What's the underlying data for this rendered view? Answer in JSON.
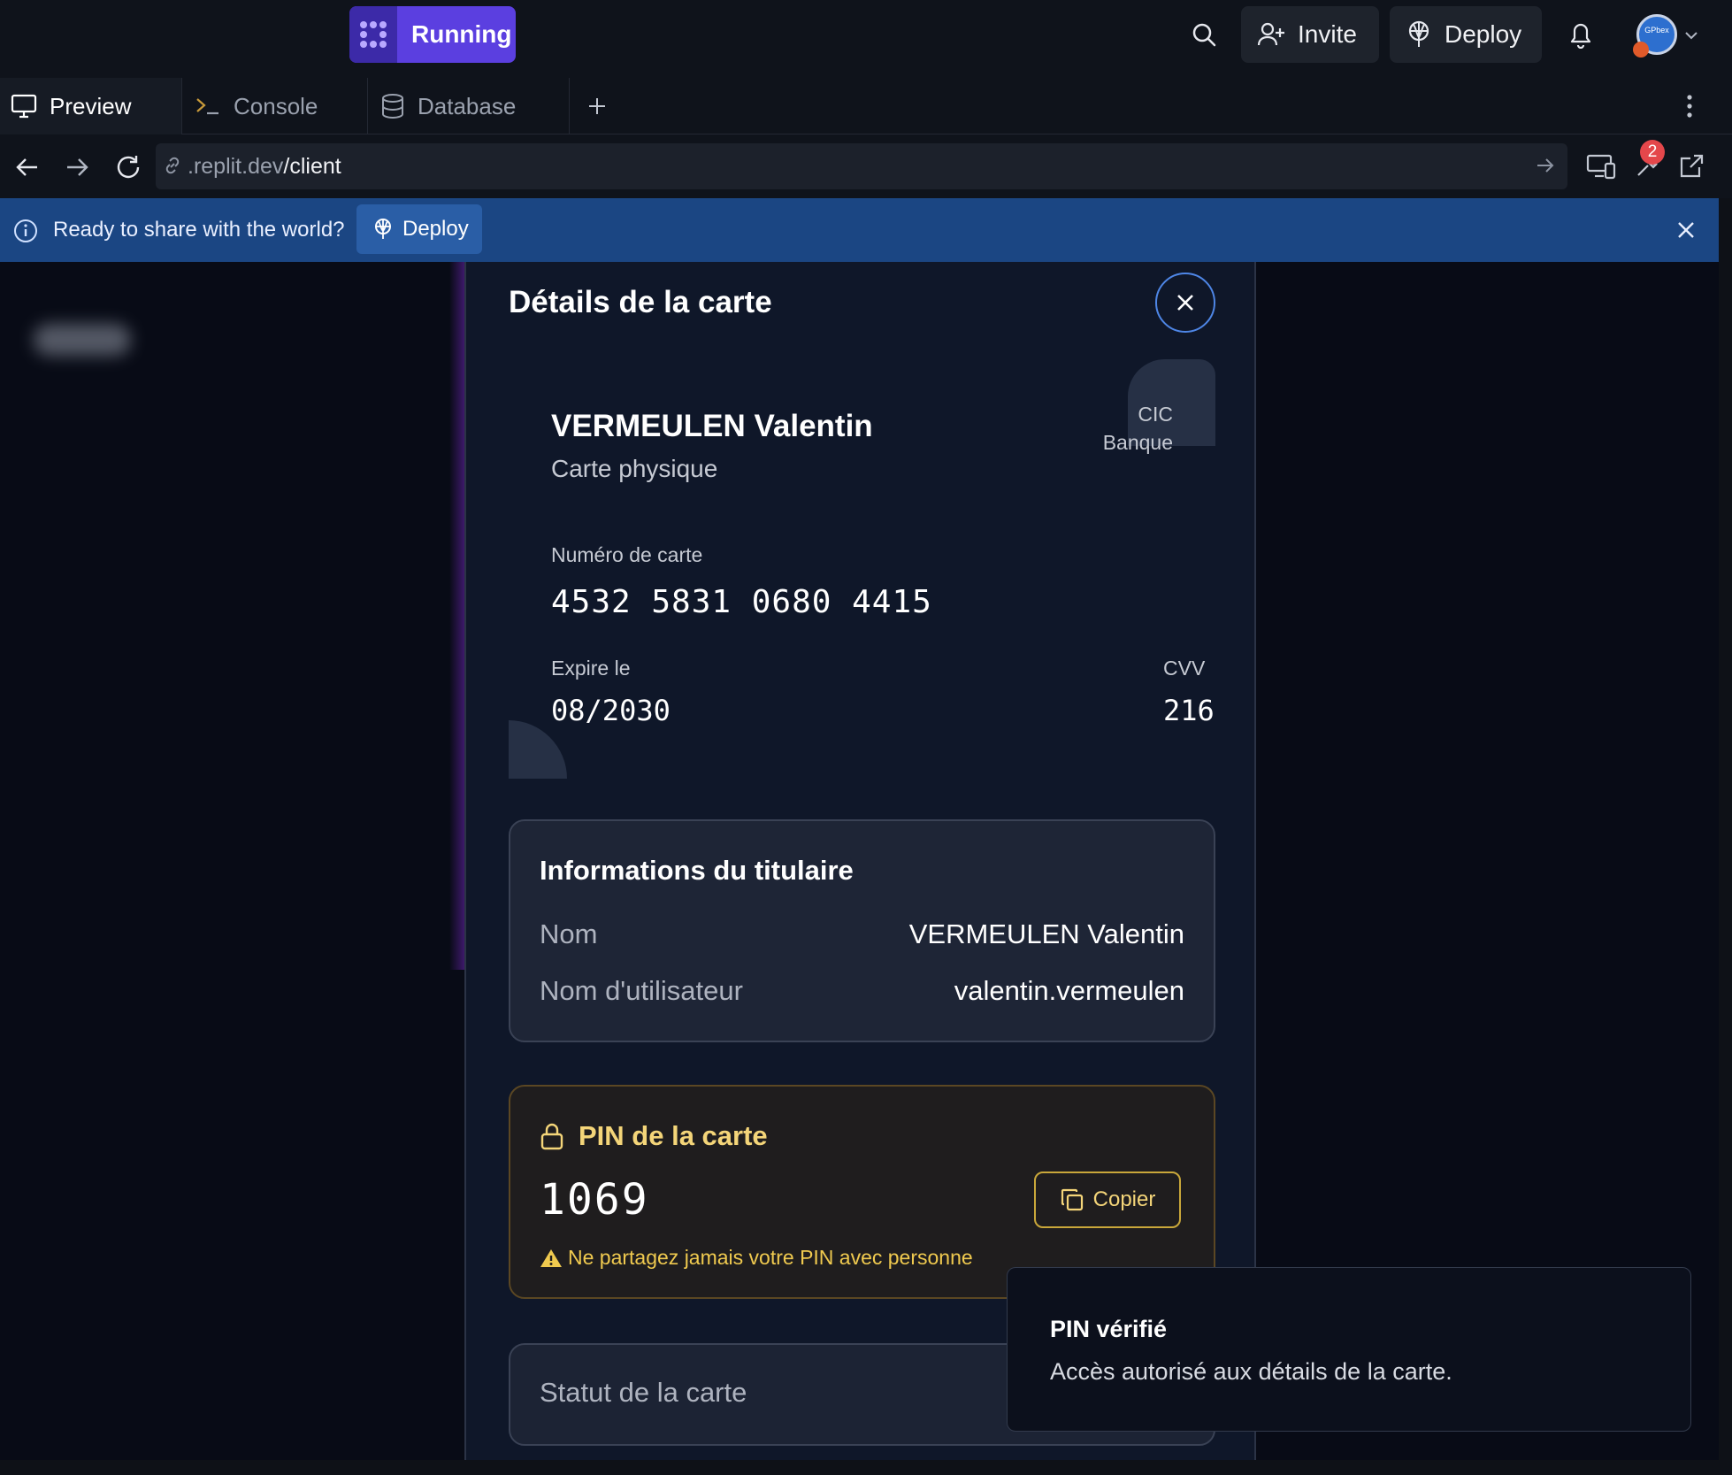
{
  "topbar": {
    "run_label": "Running",
    "invite_label": "Invite",
    "deploy_label": "Deploy",
    "avatar_text": "GPbex"
  },
  "tabs": [
    {
      "label": "Preview",
      "icon": "monitor-icon"
    },
    {
      "label": "Console",
      "icon": "terminal-icon"
    },
    {
      "label": "Database",
      "icon": "database-icon"
    }
  ],
  "address": {
    "domain": ".replit.dev",
    "path": "/client",
    "notification_count": "2"
  },
  "banner": {
    "message": "Ready to share with the world?",
    "button_label": "Deploy"
  },
  "modal": {
    "title": "Détails de la carte",
    "card": {
      "holder_name": "VERMEULEN Valentin",
      "card_type": "Carte physique",
      "bank_line1": "CIC",
      "bank_line2": "Banque",
      "number_label": "Numéro de carte",
      "number": "4532 5831 0680 4415",
      "expiry_label": "Expire le",
      "expiry": "08/2030",
      "cvv_label": "CVV",
      "cvv": "216"
    },
    "holder_info": {
      "title": "Informations du titulaire",
      "name_label": "Nom",
      "name_value": "VERMEULEN Valentin",
      "username_label": "Nom d'utilisateur",
      "username_value": "valentin.vermeulen"
    },
    "pin": {
      "title": "PIN de la carte",
      "value": "1069",
      "copy_label": "Copier",
      "warning": "Ne partagez jamais votre PIN avec personne"
    },
    "status": {
      "title": "Statut de la carte"
    }
  },
  "toast": {
    "title": "PIN vérifié",
    "message": "Accès autorisé aux détails de la carte."
  },
  "colors": {
    "accent": "#5b3fe0",
    "banner": "#1b4683",
    "pin_accent": "#f4d579"
  }
}
